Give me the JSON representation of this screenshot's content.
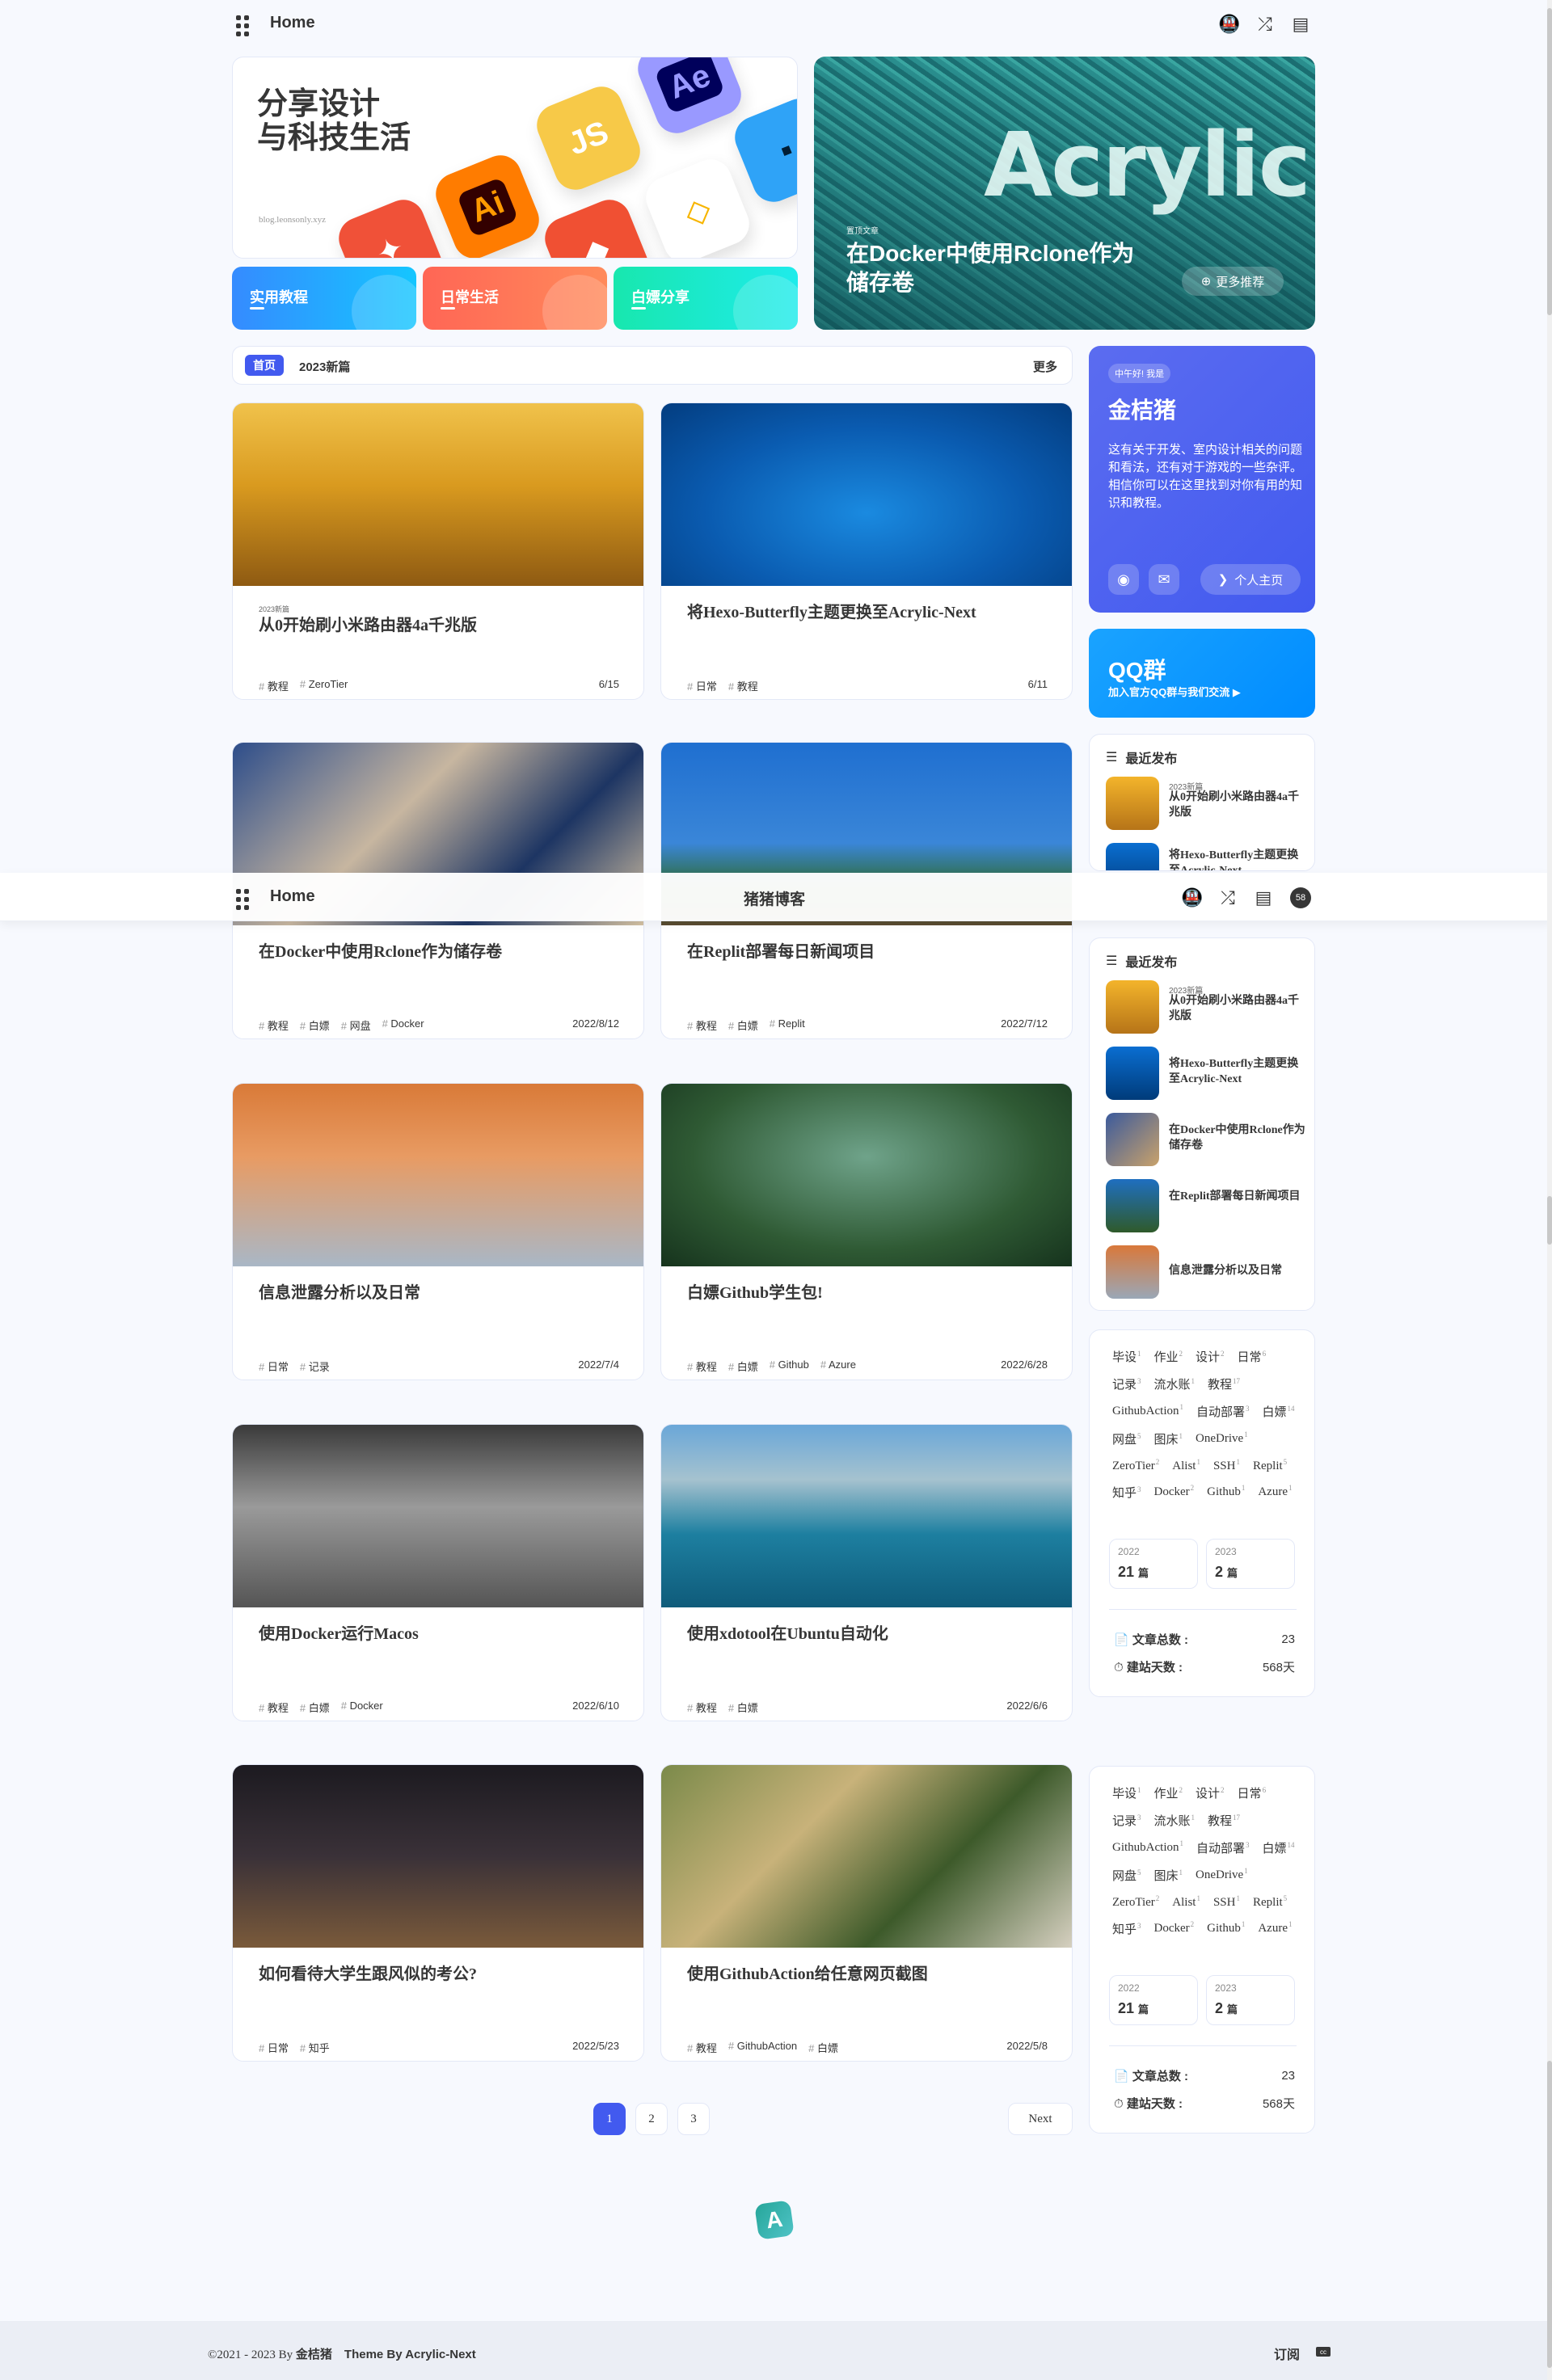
{
  "nav": {
    "home": "Home",
    "site_title": "猪猪博客",
    "count_badge": "58"
  },
  "hero": {
    "title_line1": "分享设计",
    "title_line2": "与科技生活",
    "url": "blog.leonsonly.xyz",
    "app_icons": [
      "Ai",
      "JS",
      "Ae"
    ],
    "featured": {
      "big_text": "Acrylic",
      "label": "置顶文章",
      "title": "在Docker中使用Rclone作为储存卷",
      "more": "更多推荐"
    },
    "categories": [
      "实用教程",
      "日常生活",
      "白嫖分享"
    ]
  },
  "catbar": {
    "chip": "首页",
    "current": "2023新篇",
    "more": "更多"
  },
  "posts": [
    {
      "top": "2023新篇",
      "title": "从0开始刷小米路由器4a千兆版",
      "tags": [
        "教程",
        "ZeroTier"
      ],
      "date": "6/15"
    },
    {
      "top": "",
      "title": "将Hexo-Butterfly主题更换至Acrylic-Next",
      "tags": [
        "日常",
        "教程"
      ],
      "date": "6/11"
    },
    {
      "top": "",
      "title": "在Docker中使用Rclone作为储存卷",
      "tags": [
        "教程",
        "白嫖",
        "网盘",
        "Docker"
      ],
      "date": "2022/8/12"
    },
    {
      "top": "",
      "title": "在Replit部署每日新闻项目",
      "tags": [
        "教程",
        "白嫖",
        "Replit"
      ],
      "date": "2022/7/12"
    },
    {
      "top": "",
      "title": "信息泄露分析以及日常",
      "tags": [
        "日常",
        "记录"
      ],
      "date": "2022/7/4"
    },
    {
      "top": "",
      "title": "白嫖Github学生包!",
      "tags": [
        "教程",
        "白嫖",
        "Github",
        "Azure"
      ],
      "date": "2022/6/28"
    },
    {
      "top": "",
      "title": "使用Docker运行Macos",
      "tags": [
        "教程",
        "白嫖",
        "Docker"
      ],
      "date": "2022/6/10"
    },
    {
      "top": "",
      "title": "使用xdotool在Ubuntu自动化",
      "tags": [
        "教程",
        "白嫖"
      ],
      "date": "2022/6/6"
    },
    {
      "top": "",
      "title": "如何看待大学生跟风似的考公?",
      "tags": [
        "日常",
        "知乎"
      ],
      "date": "2022/5/23"
    },
    {
      "top": "",
      "title": "使用GithubAction给任意网页截图",
      "tags": [
        "教程",
        "GithubAction",
        "白嫖"
      ],
      "date": "2022/5/8"
    }
  ],
  "author": {
    "greeting": "中午好! 我是",
    "name": "金桔猪",
    "desc": "这有关于开发、室内设计相关的问题和看法，还有对于游戏的一些杂评。相信你可以在这里找到对你有用的知识和教程。",
    "home_button": "个人主页"
  },
  "qq": {
    "title": "QQ群",
    "subtitle": "加入官方QQ群与我们交流 ▶"
  },
  "recent": {
    "heading": "最近发布",
    "items": [
      {
        "year": "2023新篇",
        "title": "从0开始刷小米路由器4a千兆版"
      },
      {
        "year": "",
        "title": "将Hexo-Butterfly主题更换至Acrylic-Next"
      },
      {
        "year": "",
        "title": "在Docker中使用Rclone作为储存卷"
      },
      {
        "year": "",
        "title": "在Replit部署每日新闻项目"
      },
      {
        "year": "",
        "title": "信息泄露分析以及日常"
      }
    ]
  },
  "tags": [
    {
      "name": "毕设",
      "count": "1"
    },
    {
      "name": "作业",
      "count": "2"
    },
    {
      "name": "设计",
      "count": "2"
    },
    {
      "name": "日常",
      "count": "6"
    },
    {
      "name": "记录",
      "count": "3"
    },
    {
      "name": "流水账",
      "count": "1"
    },
    {
      "name": "教程",
      "count": "17"
    },
    {
      "name": "GithubAction",
      "count": "1"
    },
    {
      "name": "自动部署",
      "count": "3"
    },
    {
      "name": "白嫖",
      "count": "14"
    },
    {
      "name": "网盘",
      "count": "5"
    },
    {
      "name": "图床",
      "count": "1"
    },
    {
      "name": "OneDrive",
      "count": "1"
    },
    {
      "name": "ZeroTier",
      "count": "2"
    },
    {
      "name": "Alist",
      "count": "1"
    },
    {
      "name": "SSH",
      "count": "1"
    },
    {
      "name": "Replit",
      "count": "5"
    },
    {
      "name": "知乎",
      "count": "3"
    },
    {
      "name": "Docker",
      "count": "2"
    },
    {
      "name": "Github",
      "count": "1"
    },
    {
      "name": "Azure",
      "count": "1"
    }
  ],
  "archives": [
    {
      "year": "2022",
      "count": "21",
      "unit": "篇"
    },
    {
      "year": "2023",
      "count": "2",
      "unit": "篇"
    }
  ],
  "stats": {
    "posts_label": "文章总数 :",
    "posts_value": "23",
    "days_label": "建站天数 :",
    "days_value": "568天"
  },
  "pagination": {
    "pages": [
      "1",
      "2",
      "3"
    ],
    "next": "Next"
  },
  "footer": {
    "copyright": "©2021 - 2023 By",
    "author": "金桔猪",
    "theme": "Theme By Acrylic-Next",
    "subscribe": "订阅",
    "cc": "cc"
  },
  "colors": {
    "accent": "#425aef",
    "background": "#f7f9fe",
    "qq": "#008cff"
  }
}
